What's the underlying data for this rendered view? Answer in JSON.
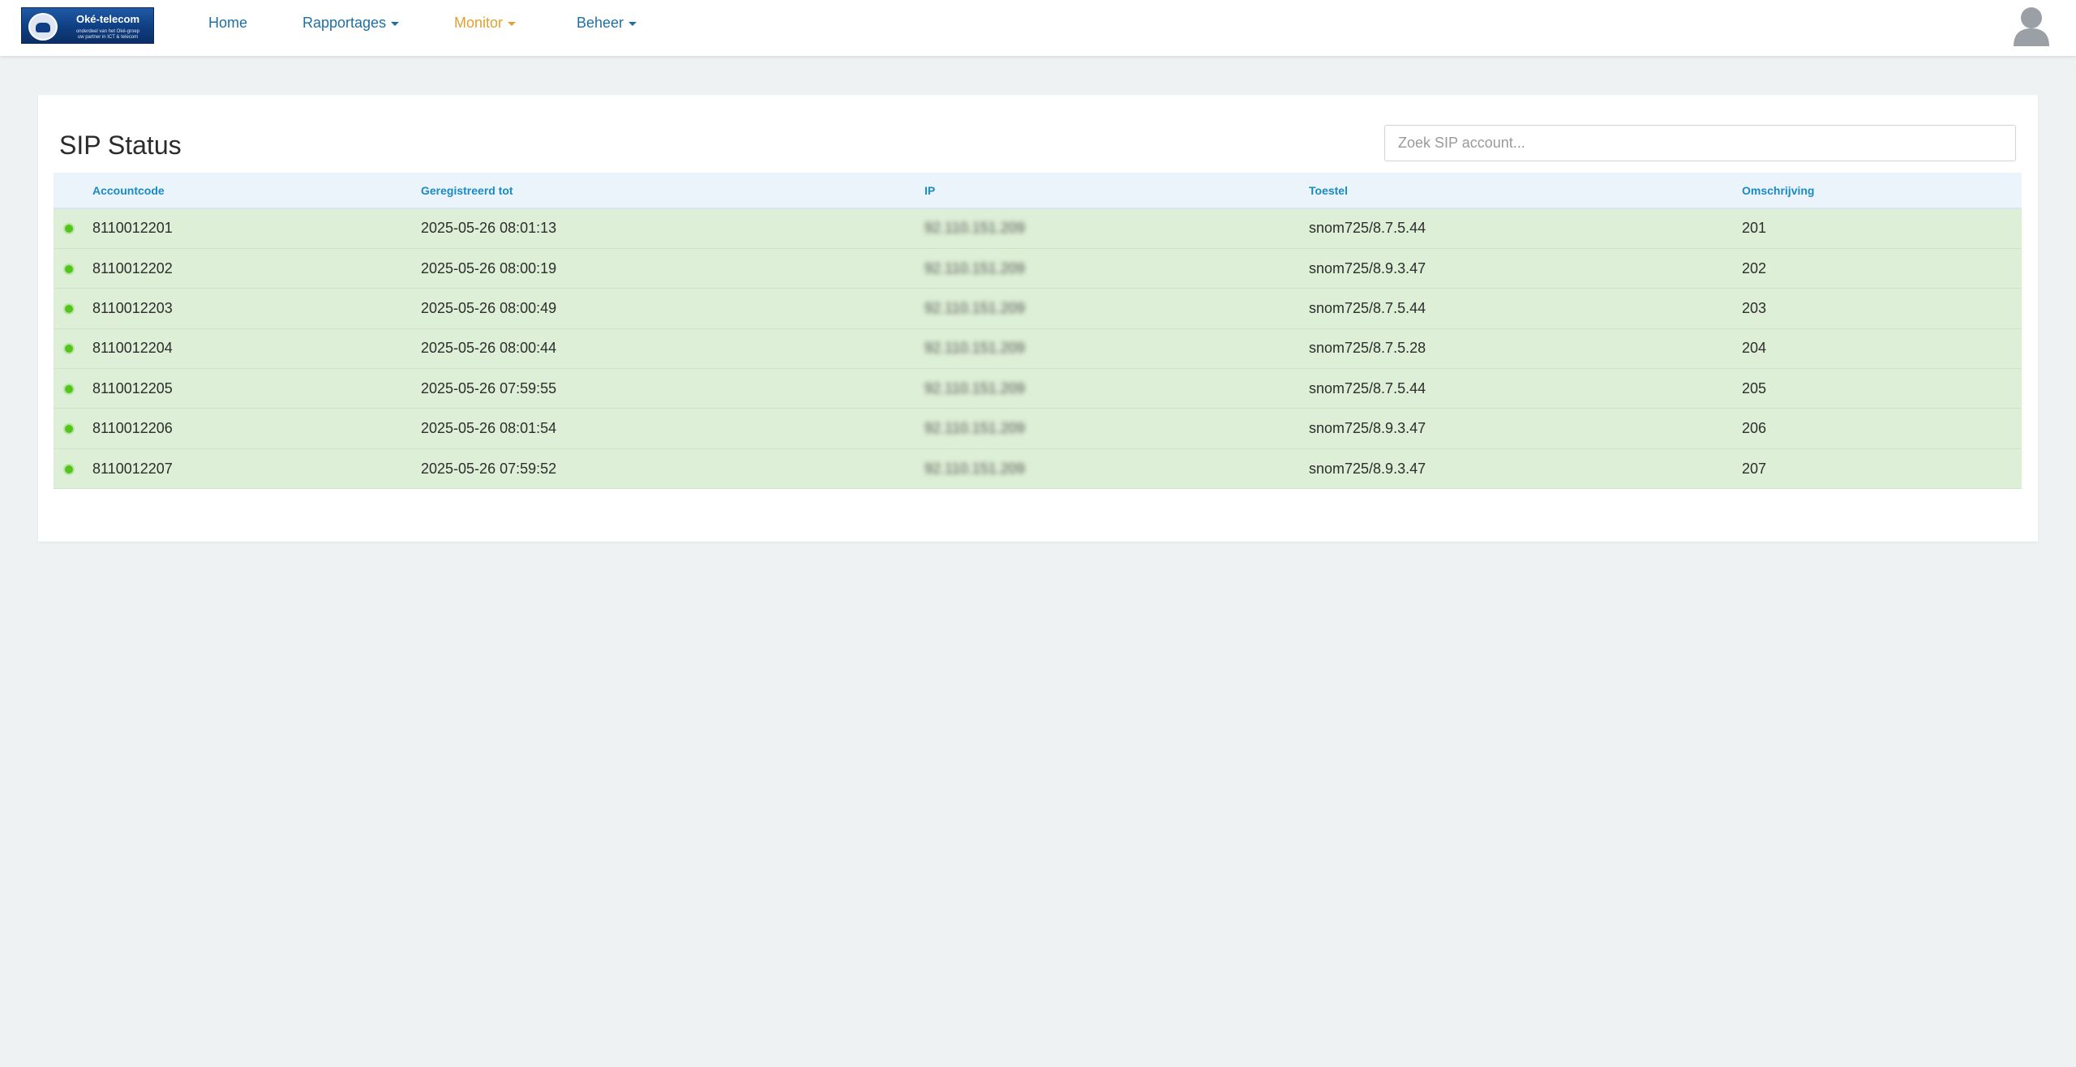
{
  "brand": {
    "name": "Oké-telecom",
    "tagline_1": "onderdeel van het Oké-groep",
    "tagline_2": "uw partner in ICT & telecom"
  },
  "nav": {
    "home": "Home",
    "rapportages": "Rapportages",
    "monitor": "Monitor",
    "beheer": "Beheer",
    "active_color": "#e2a033",
    "link_color": "#1f6fa3"
  },
  "page": {
    "title": "SIP Status",
    "search_placeholder": "Zoek SIP account..."
  },
  "table": {
    "headers": {
      "accountcode": "Accountcode",
      "geregistreerd": "Geregistreerd tot",
      "ip": "IP",
      "toestel": "Toestel",
      "omschrijving": "Omschrijving"
    },
    "rows": [
      {
        "status": "online",
        "accountcode": "8110012201",
        "registered": "2025-05-26 08:01:13",
        "ip": "92.110.151.209",
        "device": "snom725/8.7.5.44",
        "description": "201"
      },
      {
        "status": "online",
        "accountcode": "8110012202",
        "registered": "2025-05-26 08:00:19",
        "ip": "92.110.151.209",
        "device": "snom725/8.9.3.47",
        "description": "202"
      },
      {
        "status": "online",
        "accountcode": "8110012203",
        "registered": "2025-05-26 08:00:49",
        "ip": "92.110.151.209",
        "device": "snom725/8.7.5.44",
        "description": "203"
      },
      {
        "status": "online",
        "accountcode": "8110012204",
        "registered": "2025-05-26 08:00:44",
        "ip": "92.110.151.209",
        "device": "snom725/8.7.5.28",
        "description": "204"
      },
      {
        "status": "online",
        "accountcode": "8110012205",
        "registered": "2025-05-26 07:59:55",
        "ip": "92.110.151.209",
        "device": "snom725/8.7.5.44",
        "description": "205"
      },
      {
        "status": "online",
        "accountcode": "8110012206",
        "registered": "2025-05-26 08:01:54",
        "ip": "92.110.151.209",
        "device": "snom725/8.9.3.47",
        "description": "206"
      },
      {
        "status": "online",
        "accountcode": "8110012207",
        "registered": "2025-05-26 07:59:52",
        "ip": "92.110.151.209",
        "device": "snom725/8.9.3.47",
        "description": "207"
      }
    ]
  }
}
